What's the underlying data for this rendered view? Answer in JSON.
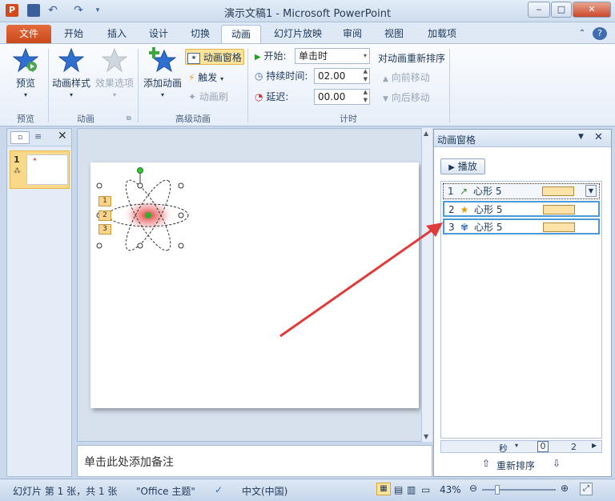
{
  "titlebar": {
    "title": "演示文稿1 - Microsoft PowerPoint",
    "app_icon": "P"
  },
  "tabs": [
    {
      "label": "文件"
    },
    {
      "label": "开始"
    },
    {
      "label": "插入"
    },
    {
      "label": "设计"
    },
    {
      "label": "切换"
    },
    {
      "label": "动画"
    },
    {
      "label": "幻灯片放映"
    },
    {
      "label": "审阅"
    },
    {
      "label": "视图"
    },
    {
      "label": "加载项"
    }
  ],
  "ribbon": {
    "preview": {
      "label": "预览",
      "group": "预览"
    },
    "animation": {
      "style_label": "动画样式",
      "effect_label": "效果选项",
      "group": "动画"
    },
    "advanced": {
      "add_label": "添加动画",
      "pane_label": "动画窗格",
      "trigger_label": "触发",
      "painter_label": "动画刷",
      "group": "高级动画"
    },
    "timing": {
      "start_label": "开始:",
      "start_value": "单击时",
      "duration_label": "持续时间:",
      "duration_value": "02.00",
      "delay_label": "延迟:",
      "delay_value": "00.00",
      "reorder_label": "对动画重新排序",
      "earlier_label": "向前移动",
      "later_label": "向后移动",
      "group": "计时"
    }
  },
  "thumb": {
    "number": "1",
    "star": "✶"
  },
  "slide": {
    "markers": [
      "1",
      "2",
      "3"
    ]
  },
  "notes": {
    "placeholder": "单击此处添加备注"
  },
  "anim_pane": {
    "title": "动画窗格",
    "play_label": "播放",
    "items": [
      {
        "num": "1",
        "name": "心形 5"
      },
      {
        "num": "2",
        "name": "心形 5"
      },
      {
        "num": "3",
        "name": "心形 5"
      }
    ],
    "timeline": {
      "unit": "秒",
      "tick0": "0",
      "tick1": "2"
    },
    "reorder": "重新排序"
  },
  "statusbar": {
    "slide_info": "幻灯片 第 1 张，共 1 张",
    "theme": "\"Office 主题\"",
    "language": "中文(中国)",
    "zoom": "43%"
  },
  "colors": {
    "accent_file": "#d5552a",
    "arrow": "#e03a3a",
    "selection": "#4d99d6"
  }
}
